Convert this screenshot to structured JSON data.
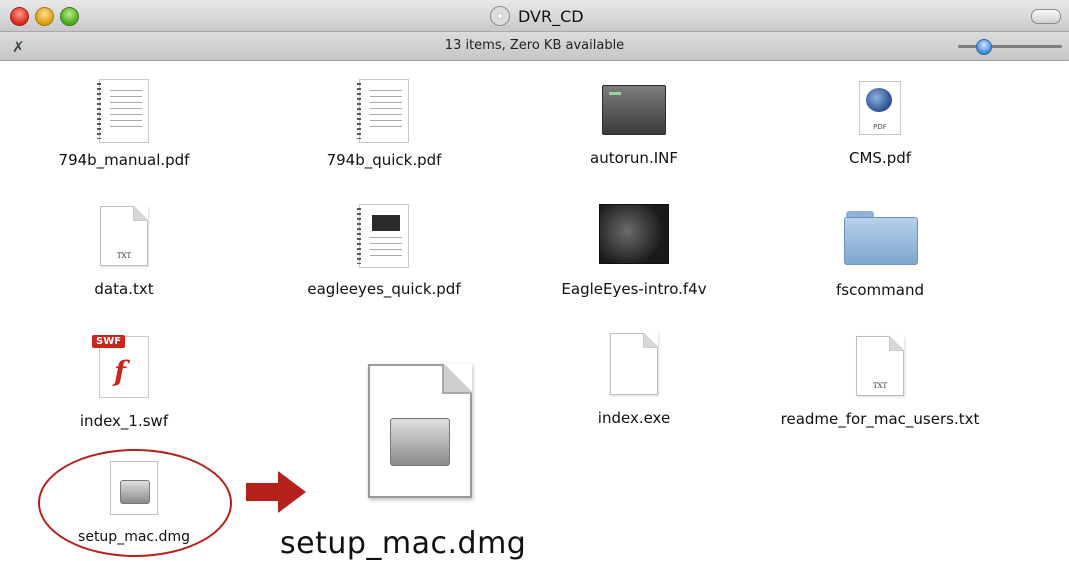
{
  "window": {
    "title": "DVR_CD",
    "status": "13 items, Zero KB available",
    "title_icon": "cd-icon"
  },
  "colors": {
    "annotation": "#b4211b",
    "folder": "#7ea6cf"
  },
  "files": [
    {
      "name": "794b_manual.pdf",
      "icon": "pdf-icon"
    },
    {
      "name": "794b_quick.pdf",
      "icon": "pdf-icon"
    },
    {
      "name": "autorun.INF",
      "icon": "window-icon"
    },
    {
      "name": "CMS.pdf",
      "icon": "pdf-icon"
    },
    {
      "name": "data.txt",
      "icon": "txt-icon",
      "ext": "TXT"
    },
    {
      "name": "eagleeyes_quick.pdf",
      "icon": "pdf-icon"
    },
    {
      "name": "EagleEyes-intro.f4v",
      "icon": "video-icon"
    },
    {
      "name": "fscommand",
      "icon": "folder-icon"
    },
    {
      "name": "index_1.swf",
      "icon": "swf-icon",
      "ext": "SWF"
    },
    {
      "name": "index.exe",
      "icon": "document-icon"
    },
    {
      "name": "readme_for_mac_users.txt",
      "icon": "txt-icon",
      "ext": "TXT"
    },
    {
      "name": "setup_mac.dmg",
      "icon": "dmg-icon"
    }
  ],
  "cms_ext": "PDF",
  "callout": {
    "label": "setup_mac.dmg"
  }
}
